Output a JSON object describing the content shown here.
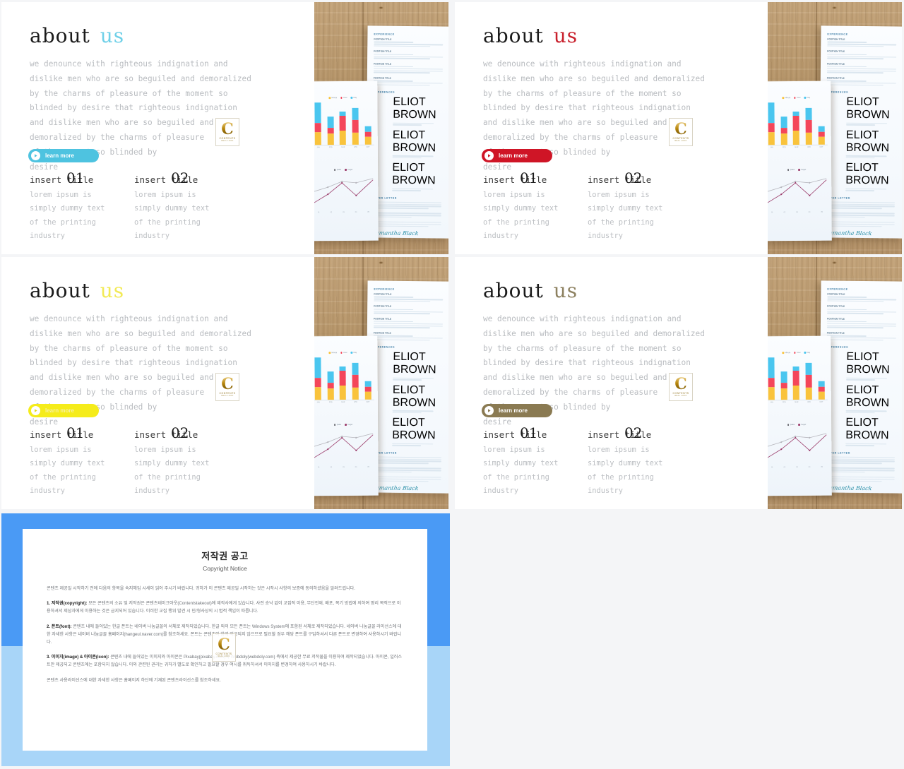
{
  "slides": [
    {
      "id": "slide-blue",
      "accent": "#4ec3e0",
      "accent_text": "#6fd0e8",
      "heading_dark": "about",
      "heading_accent": "us",
      "body_lines": [
        "we denounce with righteous indignation and",
        "dislike men who are so beguiled and demoralized",
        "by the charms of pleasure of the moment so",
        "blinded by desire that righteous indignation",
        "and dislike men who are so beguiled and",
        "demoralized by the charms of pleasure",
        "of the moment so blinded by",
        "desire"
      ],
      "button_label": "learn more",
      "columns": [
        {
          "title": "insert title",
          "number": "01",
          "body": [
            "lorem ipsum is",
            "simply dummy text",
            "of the printing",
            "industry"
          ]
        },
        {
          "title": "insert title",
          "number": "02",
          "body": [
            "lorem ipsum is",
            "simply dummy text",
            "of the printing",
            "industry"
          ]
        }
      ]
    },
    {
      "id": "slide-red",
      "accent": "#cf1526",
      "accent_text": "#c8202c",
      "heading_dark": "about",
      "heading_accent": "us",
      "body_lines": [
        "we denounce with righteous indignation and",
        "dislike men who are so beguiled and demoralized",
        "by the charms of pleasure of the moment so",
        "blinded by desire that righteous indignation",
        "and dislike men who are so beguiled and",
        "demoralized by the charms of pleasure",
        "of the moment so blinded by",
        "desire"
      ],
      "button_label": "learn more",
      "columns": [
        {
          "title": "insert title",
          "number": "01",
          "body": [
            "lorem ipsum is",
            "simply dummy text",
            "of the printing",
            "industry"
          ]
        },
        {
          "title": "insert title",
          "number": "02",
          "body": [
            "lorem ipsum is",
            "simply dummy text",
            "of the printing",
            "industry"
          ]
        }
      ]
    },
    {
      "id": "slide-yellow",
      "accent": "#f5ec1a",
      "accent_text": "#f2ea55",
      "heading_dark": "about",
      "heading_accent": "us",
      "body_lines": [
        "we denounce with righteous indignation and",
        "dislike men who are so beguiled and demoralized",
        "by the charms of pleasure of the moment so",
        "blinded by desire that righteous indignation",
        "and dislike men who are so beguiled and",
        "demoralized by the charms of pleasure",
        "of the moment so blinded by",
        "desire"
      ],
      "button_label": "learn more",
      "columns": [
        {
          "title": "insert title",
          "number": "01",
          "body": [
            "lorem ipsum is",
            "simply dummy text",
            "of the printing",
            "industry"
          ]
        },
        {
          "title": "insert title",
          "number": "02",
          "body": [
            "lorem ipsum is",
            "simply dummy text",
            "of the printing",
            "industry"
          ]
        }
      ]
    },
    {
      "id": "slide-brown",
      "accent": "#8a7a52",
      "accent_text": "#8d8160",
      "heading_dark": "about",
      "heading_accent": "us",
      "body_lines": [
        "we denounce with righteous indignation and",
        "dislike men who are so beguiled and demoralized",
        "by the charms of pleasure of the moment so",
        "blinded by desire that righteous indignation",
        "and dislike men who are so beguiled and",
        "demoralized by the charms of pleasure",
        "of the moment so blinded by",
        "desire"
      ],
      "button_label": "learn more",
      "columns": [
        {
          "title": "insert title",
          "number": "01",
          "body": [
            "lorem ipsum is",
            "simply dummy text",
            "of the printing",
            "industry"
          ]
        },
        {
          "title": "insert title",
          "number": "02",
          "body": [
            "lorem ipsum is",
            "simply dummy text",
            "of the printing",
            "industry"
          ]
        }
      ]
    }
  ],
  "logo": {
    "letter": "C",
    "name": "CONTENTS",
    "tagline": "REAL LOOK"
  },
  "photo": {
    "resume": {
      "sections": [
        "EXPERIENCE",
        "REFERENCES",
        "COVER LETTER"
      ],
      "entry_titles": [
        "POSITION TITLE",
        "POSITION TITLE",
        "POSITION TITLE",
        "POSITION TITLE"
      ],
      "reference_titles": [
        "ELIOT BROWN",
        "ELIOT BROWN",
        "ELIOT BROWN"
      ],
      "signature": "Samantha Black"
    }
  },
  "chart_data": [
    {
      "type": "bar",
      "title": "",
      "categories": [
        "JAN",
        "FEB",
        "MAR",
        "APR",
        "MAY"
      ],
      "legend": [
        "Minute",
        "Hour",
        "Day"
      ],
      "legend_position": "top-right",
      "series": [
        {
          "name": "Minute",
          "color": "#f9c33c",
          "values": [
            30,
            28,
            34,
            30,
            18
          ]
        },
        {
          "name": "Hour",
          "color": "#f4465a",
          "values": [
            22,
            14,
            36,
            30,
            12
          ]
        },
        {
          "name": "Day",
          "color": "#4ac6ef",
          "values": [
            48,
            26,
            10,
            28,
            14
          ]
        }
      ],
      "stacked": true,
      "xlabel": "",
      "ylabel": "",
      "grid": false
    },
    {
      "type": "line",
      "title": "",
      "x": [
        "01",
        "02",
        "03",
        "04",
        "05"
      ],
      "legend": [
        "Sales",
        "Target"
      ],
      "legend_position": "top-right",
      "series": [
        {
          "name": "Sales",
          "color": "#b6b6bd",
          "values": [
            48,
            56,
            66,
            64,
            72
          ]
        },
        {
          "name": "Target",
          "color": "#9b3c6b",
          "values": [
            14,
            34,
            58,
            32,
            62
          ]
        }
      ],
      "xlabel": "",
      "ylabel": "",
      "grid": false
    }
  ],
  "copyright": {
    "title": "저작권 공고",
    "subtitle": "Copyright Notice",
    "intro": "콘텐츠 제공일 시작하기 전에 다음의 항목을 숙지해입 시세이 읽어 주시기 바랍니다. 귀하가 이 콘텐츠 제공일 시작하는 것은 시작시 사항의 보증에 동의하셨음을 알려드립니다.",
    "sections": [
      {
        "label": "1. 저작권(copyright):",
        "text": "모든 콘텐츠의 소유 및 저작권은 콘텐츠테이크아웃(Contentstakeout)에 제작사에게 있습니다. 사전 승낙 없이 교집적 이용, 무단전재, 배포, 복기 방법에 의하여 영리 목적으로 이용하셔서 제삼자에게 이용하는 것은 금지되어 있습니다. 이러한 교집 행위 발견 시 민/형사상의 시 법적 책임이 따릅니다."
      },
      {
        "label": "2. 폰트(font):",
        "text": "콘텐츠 내에 들어있는 한글 폰트는 네이버 나눔글꼴의 서체로 제작되었습니다. 한글 외의 모든 폰트는 Windows System에 포함된 서체로 제작되었습니다. 네이버 나눔글꼴 라이선스에 대한 자세한 사항은 네이버 나눔글꼴 홈페이지(hangeul.naver.com)를 참조하세요. 폰트는 콘텐츠와 함께 제공되지 않으므로 필요할 경우 해당 폰트를 구입하셔서 다른 폰트로 변경하여 사용하시기 바랍니다."
      },
      {
        "label": "3. 이미지(image) & 아이콘(icon):",
        "text": "콘텐츠 내에 들어있는 이미지와 아이콘은 Pixabay(pixabay.com)와 Webdoly(webdoly.com) 측에서 제공한 무료 저작물을 이용하여 제작되었습니다. 아이콘, 일러스트만 제공되고 콘텐츠에는 포함되지 않습니다. 이와 관련된 권리는 귀하가 별도로 확인하고 필요할 경우 여시를 취득하셔서 이미지를 변경하여 사용하시기 바랍니다."
      }
    ],
    "outro": "콘텐츠 사용라이선스에 대한 자세한 사항은 홈페이지 하단에 기재된 콘텐츠라이선스를 참조하세요."
  }
}
